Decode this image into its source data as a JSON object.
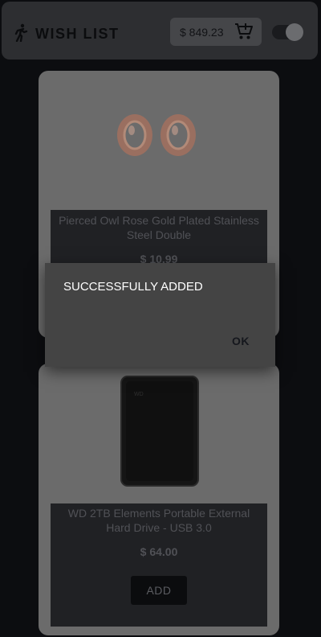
{
  "header": {
    "title": "WISH LIST",
    "cart_total": "$ 849.23",
    "logo_icon": "running-figure-icon",
    "cart_icon": "add-to-cart-icon",
    "theme_toggle_on": true
  },
  "products": [
    {
      "title": "Pierced Owl Rose Gold Plated Stainless Steel Double",
      "price": "$ 10.99",
      "image": "rose-gold-ear-plugs"
    },
    {
      "title": "WD 2TB Elements Portable External Hard Drive - USB 3.0",
      "price": "$ 64.00",
      "image": "black-external-hard-drive",
      "add_label": "ADD"
    }
  ],
  "dialog": {
    "message": "SUCCESSFULLY ADDED",
    "ok_label": "OK"
  },
  "colors": {
    "background": "#0c0d10",
    "header": "#2d2e31",
    "card": "#6b6b6b",
    "dialog": "#444444"
  }
}
